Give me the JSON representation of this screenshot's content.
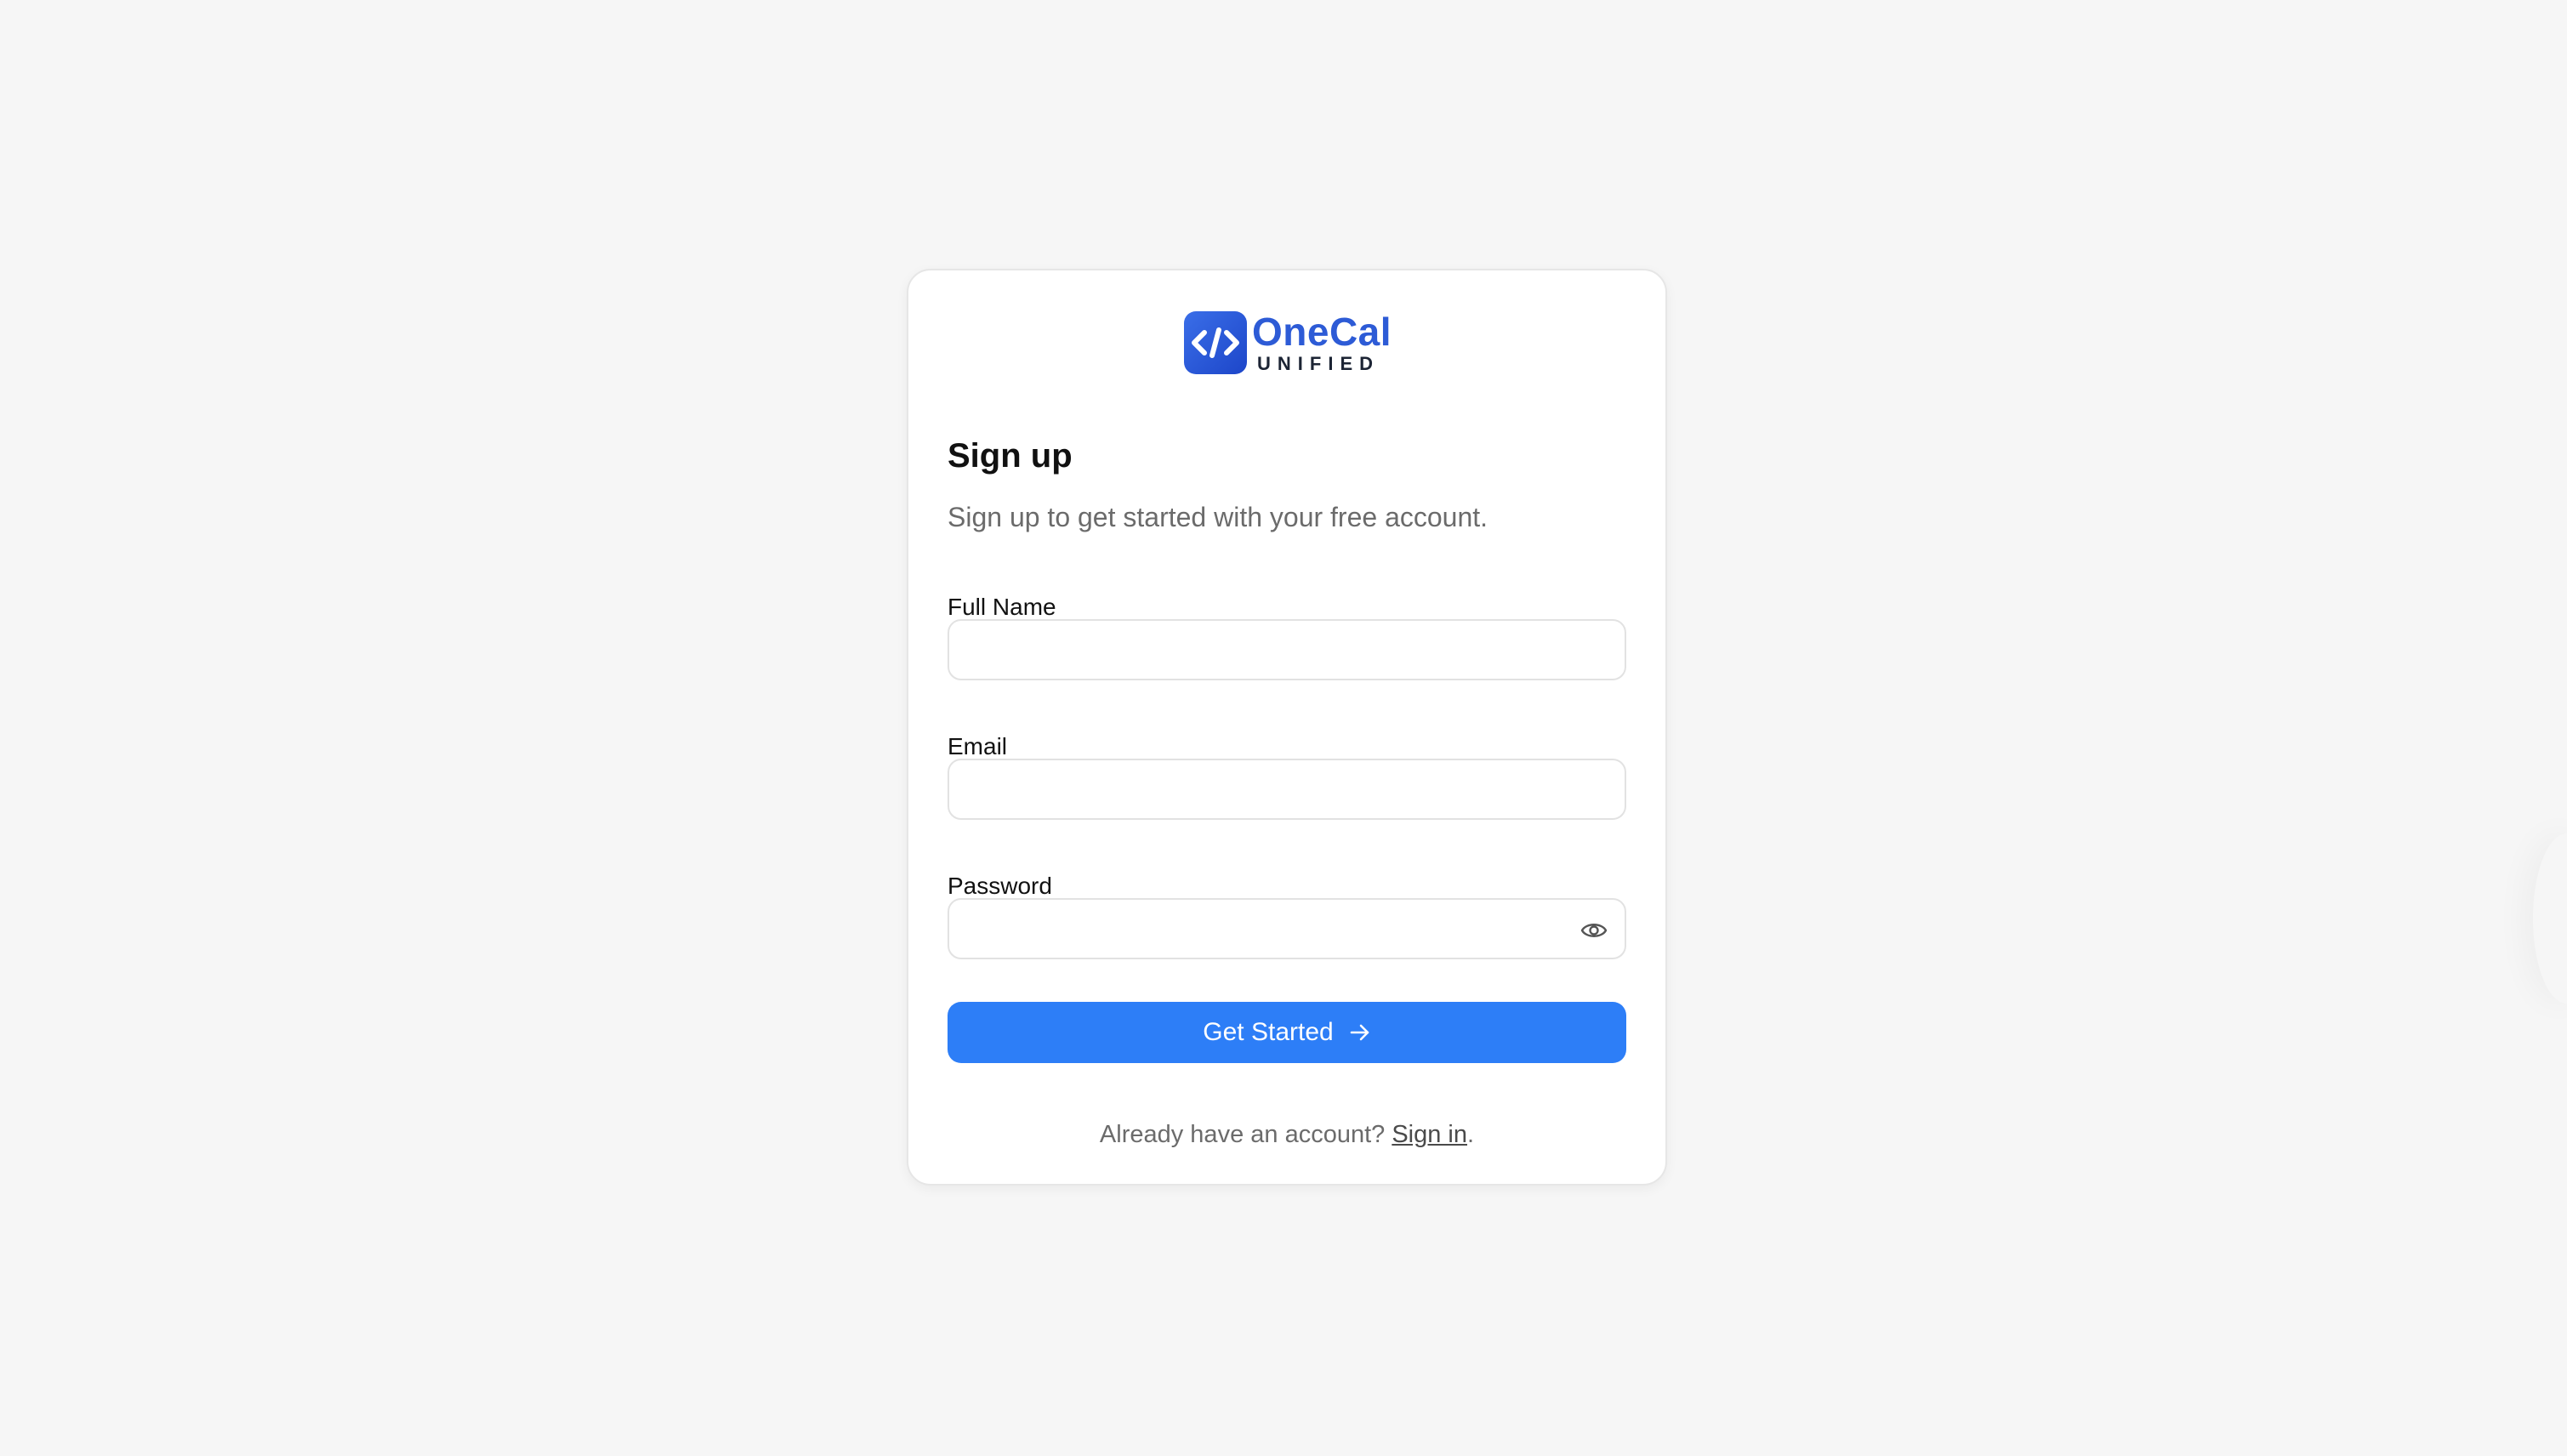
{
  "brand": {
    "name": "OneCal",
    "sub": "UNIFIED",
    "color": "#2d5bd6"
  },
  "form": {
    "title": "Sign up",
    "subtitle": "Sign up to get started with your free account.",
    "full_name": {
      "label": "Full Name",
      "value": "",
      "placeholder": ""
    },
    "email": {
      "label": "Email",
      "value": "",
      "placeholder": ""
    },
    "password": {
      "label": "Password",
      "value": "",
      "placeholder": "",
      "toggle_icon": "eye-icon"
    },
    "submit_label": "Get Started",
    "submit_icon": "arrow-right-icon",
    "accent": "#2d7ef7"
  },
  "footer": {
    "prompt": "Already have an account? ",
    "link": "Sign in",
    "suffix": "."
  }
}
